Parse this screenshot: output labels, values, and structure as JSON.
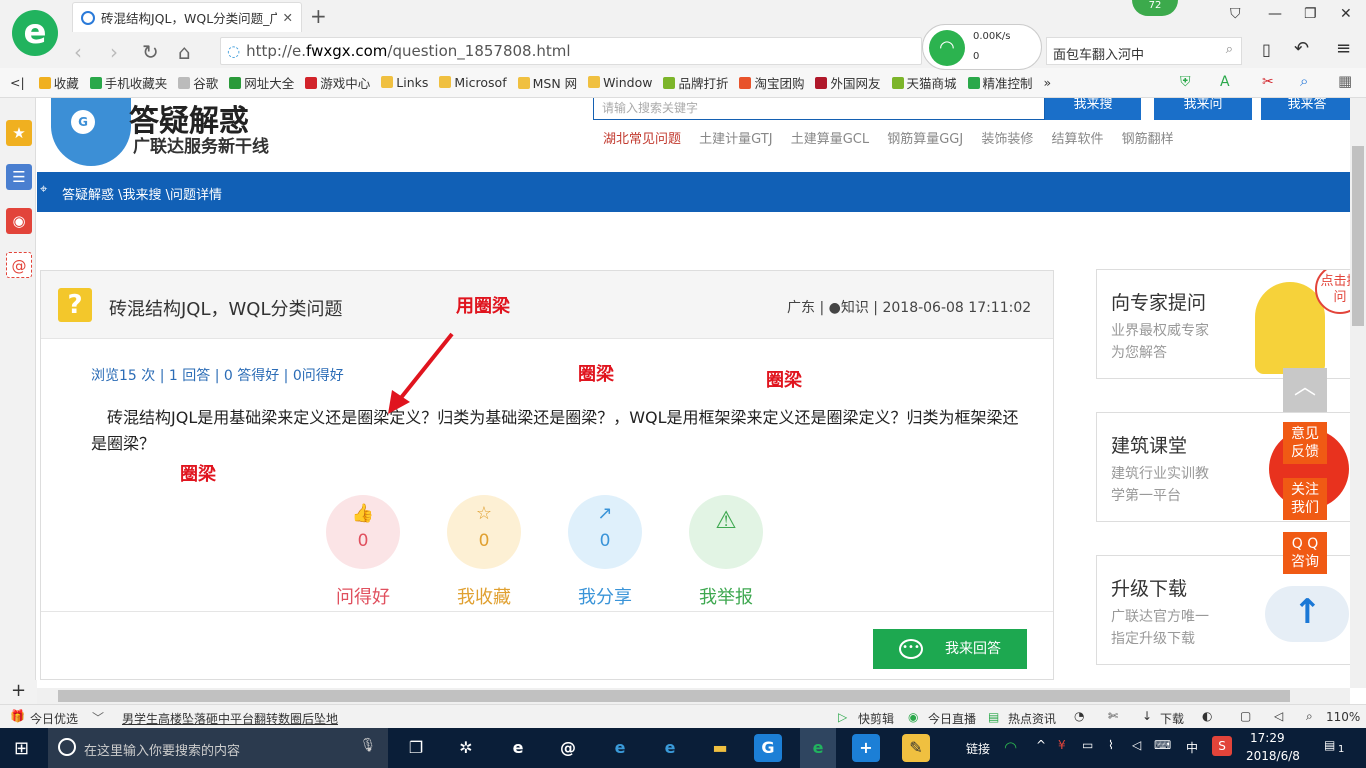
{
  "browser": {
    "tab_title": "砖混结构JQL，WQL分类问题_广",
    "tab_close": "✕",
    "new_tab": "+",
    "logo_letter": "e",
    "badge": "72",
    "url_prefix": "http://e.",
    "url_domain": "fwxgx.com",
    "url_path": "/question_1857808.html",
    "speed": "0.00K/s",
    "conn_count": "0",
    "search_text": "面包车翻入河中"
  },
  "bookmarks": [
    {
      "label": "收藏",
      "color": "#f0b020"
    },
    {
      "label": "手机收藏夹",
      "color": "#2aa84a"
    },
    {
      "label": "谷歌",
      "color": "#bbbbbb"
    },
    {
      "label": "网址大全",
      "color": "#2a9a3a"
    },
    {
      "label": "游戏中心",
      "color": "#d2232a"
    },
    {
      "label": "Links",
      "color": "#f0c040"
    },
    {
      "label": "Microsof",
      "color": "#f0c040"
    },
    {
      "label": "MSN 网",
      "color": "#f0c040"
    },
    {
      "label": "Window",
      "color": "#f0c040"
    },
    {
      "label": "品牌打折",
      "color": "#7cb52a"
    },
    {
      "label": "淘宝团购",
      "color": "#e8532b"
    },
    {
      "label": "外国网友",
      "color": "#b0182a"
    },
    {
      "label": "天猫商城",
      "color": "#7cb52a"
    },
    {
      "label": "精准控制",
      "color": "#2aa84a"
    },
    {
      "label": "»",
      "color": ""
    }
  ],
  "site": {
    "title": "答疑解惑",
    "subtitle": "广联达服务新干线",
    "search_placeholder": "请输入搜索关键字",
    "btn_search": "我来搜",
    "btn_ask": "我来问",
    "btn_answer": "我来答",
    "hot_links": [
      "湖北常见问题",
      "土建计量GTJ",
      "土建算量GCL",
      "钢筋算量GGJ",
      "装饰装修",
      "结算软件",
      "钢筋翻样"
    ],
    "breadcrumb": "答疑解惑 \\我来搜 \\问题详情"
  },
  "question": {
    "title": "砖混结构JQL，WQL分类问题",
    "meta_region": "广东",
    "meta_user": "知识",
    "meta_time": "2018-06-08 17:11:02",
    "stats": "浏览15 次 | 1 回答 | 0 答得好 | 0问得好",
    "body": "砖混结构JQL是用基础梁来定义还是圈梁定义？归类为基础梁还是圈梁？，WQL是用框架梁来定义还是圈梁定义？归类为框架梁还是圈梁？",
    "actions": [
      {
        "label": "问得好",
        "count": "0",
        "icon": "👍",
        "bg": "#fbe4e6",
        "fg": "#e0505e"
      },
      {
        "label": "我收藏",
        "count": "0",
        "icon": "☆",
        "bg": "#fdf0d4",
        "fg": "#e0a030"
      },
      {
        "label": "我分享",
        "count": "0",
        "icon": "↗",
        "bg": "#dff0fb",
        "fg": "#3a94d8"
      },
      {
        "label": "我举报",
        "count": "0",
        "icon": "⚠",
        "bg": "#e2f4e4",
        "fg": "#3ea850"
      }
    ],
    "answer_button": "我来回答"
  },
  "annotations": {
    "a1": "用圈梁",
    "a2": "圈梁",
    "a3": "圈梁",
    "a4": "圈梁"
  },
  "right_cards": [
    {
      "title": "向专家提问",
      "line1": "业界最权威专家",
      "line2": "为您解答",
      "tag": "点击提问"
    },
    {
      "title": "建筑课堂",
      "line1": "建筑行业实训教",
      "line2": "学第一平台"
    },
    {
      "title": "升级下载",
      "line1": "广联达官方唯一",
      "line2": "指定升级下载"
    }
  ],
  "floating": {
    "up": "︿",
    "feedback": "意见反馈",
    "follow": "关注我们",
    "qq": "Q Q咨询"
  },
  "statusbar": {
    "left": "今日优选",
    "news": "男学生高楼坠落砸中平台翻转数圈后坠地",
    "items": [
      "快剪辑",
      "今日直播",
      "热点资讯"
    ],
    "download": "下载",
    "zoom": "110%"
  },
  "taskbar": {
    "search_placeholder": "在这里输入你要搜索的内容",
    "link_label": "链接",
    "ime": "中",
    "time": "17:29",
    "date": "2018/6/8",
    "notif": "1"
  }
}
